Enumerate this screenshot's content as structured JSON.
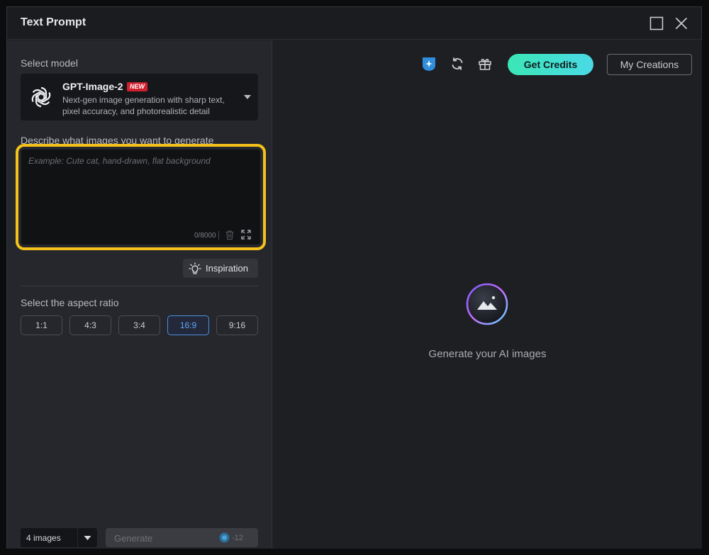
{
  "window": {
    "title": "Text Prompt"
  },
  "left_panel": {
    "select_model_label": "Select model",
    "model": {
      "name": "GPT-Image-2",
      "badge": "NEW",
      "description": "Next-gen image generation with sharp text, pixel accuracy, and photorealistic detail"
    },
    "prompt": {
      "label": "Describe what images you want to generate",
      "placeholder": "Example: Cute cat, hand-drawn, flat background",
      "value": "",
      "counter": "0/8000"
    },
    "inspiration_label": "Inspiration",
    "aspect_ratio": {
      "label": "Select the aspect ratio",
      "options": [
        "1:1",
        "4:3",
        "3:4",
        "16:9",
        "9:16"
      ],
      "selected": "16:9"
    },
    "image_count": {
      "selected": "4 images"
    },
    "generate": {
      "label": "Generate",
      "cost": "-12"
    }
  },
  "right_panel": {
    "get_credits_label": "Get Credits",
    "my_creations_label": "My Creations",
    "empty_state_text": "Generate your AI images"
  },
  "colors": {
    "accent_highlight": "#f4c21a",
    "active_ratio": "#4a8fe0",
    "credits_gradient_start": "#3be6b5",
    "credits_gradient_end": "#4ad9e6",
    "new_badge": "#d01f2f"
  }
}
